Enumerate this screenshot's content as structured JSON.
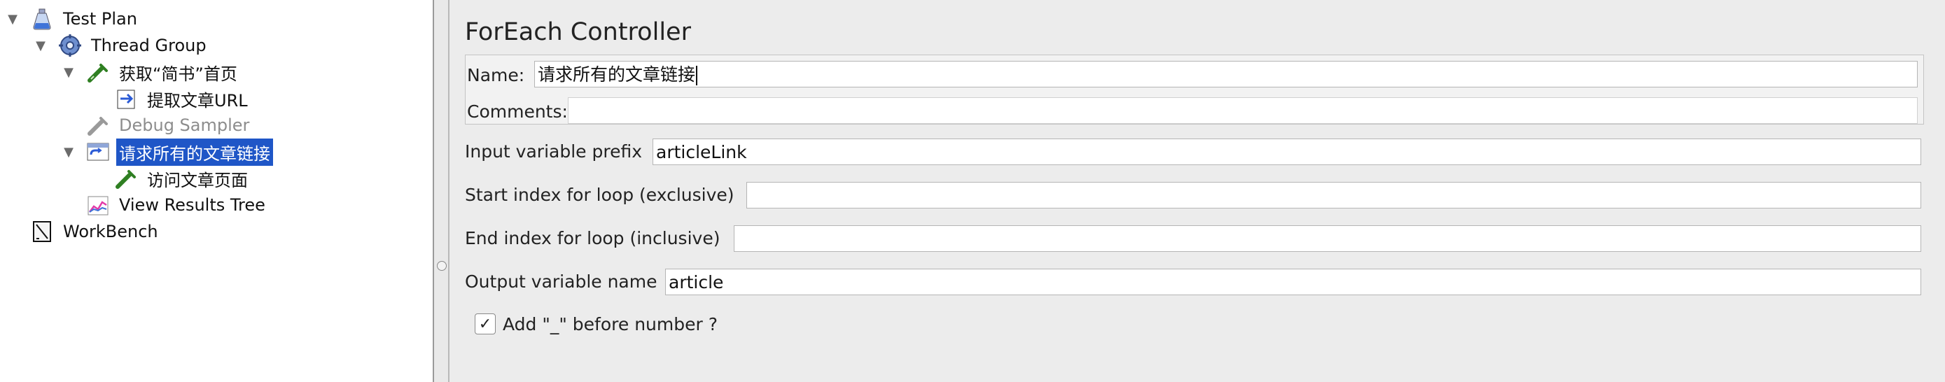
{
  "tree": {
    "items": [
      {
        "label": "Test Plan",
        "icon": "flask-icon",
        "state": "normal",
        "expanded": true
      },
      {
        "label": "Thread Group",
        "icon": "gear-icon",
        "state": "normal",
        "expanded": true
      },
      {
        "label": "获取“简书”首页",
        "icon": "pipette-icon",
        "state": "normal",
        "expanded": true
      },
      {
        "label": "提取文章URL",
        "icon": "extractor-icon",
        "state": "normal"
      },
      {
        "label": "Debug Sampler",
        "icon": "pipette-icon",
        "state": "disabled"
      },
      {
        "label": "请求所有的文章链接",
        "icon": "loop-controller-icon",
        "state": "selected",
        "expanded": true
      },
      {
        "label": "访问文章页面",
        "icon": "pipette-icon",
        "state": "normal"
      },
      {
        "label": "View Results Tree",
        "icon": "chart-icon",
        "state": "normal"
      },
      {
        "label": "WorkBench",
        "icon": "workbench-icon",
        "state": "normal"
      }
    ]
  },
  "form": {
    "title": "ForEach Controller",
    "name_label": "Name:",
    "name_value": "请求所有的文章链接",
    "comments_label": "Comments:",
    "comments_value": "",
    "input_prefix_label": "Input variable prefix",
    "input_prefix_value": "articleLink",
    "start_index_label": "Start index for loop (exclusive)",
    "start_index_value": "",
    "end_index_label": "End index for loop (inclusive)",
    "end_index_value": "",
    "output_var_label": "Output variable name",
    "output_var_value": "article",
    "add_underscore_label": "Add \"_\" before number ?",
    "add_underscore_checked": true,
    "checkbox_mark": "✓"
  },
  "colors": {
    "selection": "#1f56c7",
    "disabled_text": "#8d8d8d"
  }
}
